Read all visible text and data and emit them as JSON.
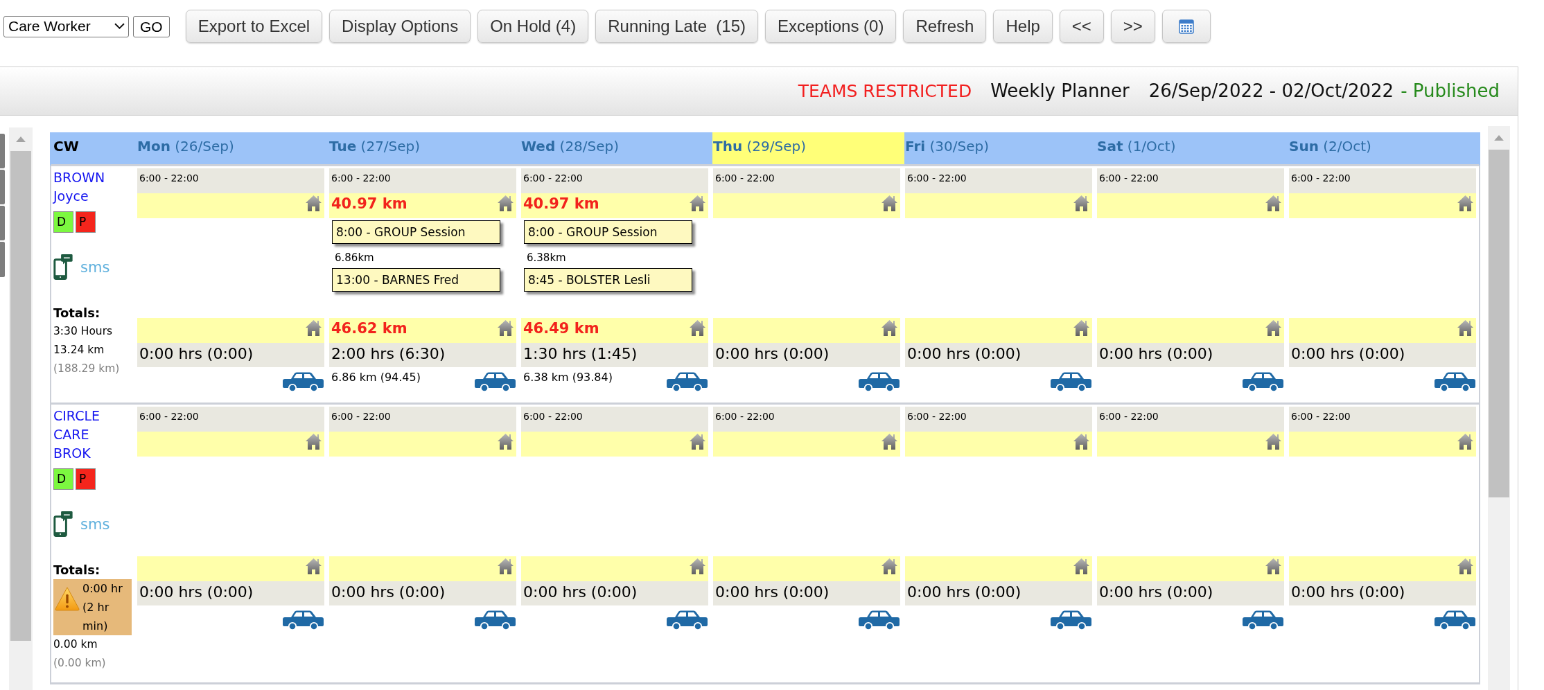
{
  "toolbar": {
    "view_select": {
      "value": "Care Worker"
    },
    "go_button": {
      "label": "GO"
    },
    "buttons": [
      {
        "kind": "text",
        "label": "Export to Excel"
      },
      {
        "kind": "text",
        "label": "Display Options"
      },
      {
        "kind": "text",
        "label": "On Hold (4)"
      },
      {
        "kind": "text",
        "label": "Running Late  (15)"
      },
      {
        "kind": "text",
        "label": "Exceptions (0)"
      },
      {
        "kind": "text",
        "label": "Refresh"
      },
      {
        "kind": "text",
        "label": "Help"
      },
      {
        "kind": "text",
        "label": "<<"
      },
      {
        "kind": "text",
        "label": ">>"
      },
      {
        "kind": "calendar"
      }
    ]
  },
  "header": {
    "restriction": "TEAMS RESTRICTED",
    "title": "Weekly Planner",
    "date_range": "26/Sep/2022 - 02/Oct/2022",
    "status": "- Published"
  },
  "planner": {
    "corner_label": "CW",
    "days": [
      {
        "label": "**Mon** (26/Sep)",
        "today": false
      },
      {
        "label": "**Tue** (27/Sep)",
        "today": false
      },
      {
        "label": "**Wed** (28/Sep)",
        "today": false
      },
      {
        "label": "**Thu** (29/Sep)",
        "today": true
      },
      {
        "label": "**Fri** (30/Sep)",
        "today": false
      },
      {
        "label": "**Sat** (1/Oct)",
        "today": false
      },
      {
        "label": "**Sun** (2/Oct)",
        "today": false
      }
    ],
    "workers": [
      {
        "name": "BROWN Joyce",
        "badges": [
          {
            "label": "D",
            "color": "#7cf840"
          },
          {
            "label": "P",
            "color": "#f4251c"
          }
        ],
        "sms_label": "sms",
        "totals": {
          "label": "Totals:",
          "hours": "3:30 Hours",
          "warning": false,
          "distance": "13.24 km",
          "total_distance": "(188.29 km)"
        },
        "days": [
          {
            "shift": "6:00 - 22:00",
            "hours": "0:00 hrs (0:00)"
          },
          {
            "shift": "6:00 - 22:00",
            "start_distance": "40.97 km",
            "items": [
              {
                "kind": "visit",
                "label": "8:00 - GROUP Session"
              },
              {
                "kind": "travel",
                "label": "6.86km"
              },
              {
                "kind": "visit",
                "label": "13:00 - BARNES Fred"
              }
            ],
            "end_distance": "46.62 km",
            "hours": "2:00 hrs (6:30)",
            "travel": "6.86 km (94.45)"
          },
          {
            "shift": "6:00 - 22:00",
            "start_distance": "40.97 km",
            "items": [
              {
                "kind": "visit",
                "label": "8:00 - GROUP Session"
              },
              {
                "kind": "travel",
                "label": "6.38km"
              },
              {
                "kind": "visit",
                "label": "8:45 - BOLSTER Lesli"
              }
            ],
            "end_distance": "46.49 km",
            "hours": "1:30 hrs (1:45)",
            "travel": "6.38 km (93.84)"
          },
          {
            "shift": "6:00 - 22:00",
            "hours": "0:00 hrs (0:00)"
          },
          {
            "shift": "6:00 - 22:00",
            "hours": "0:00 hrs (0:00)"
          },
          {
            "shift": "6:00 - 22:00",
            "hours": "0:00 hrs (0:00)"
          },
          {
            "shift": "6:00 - 22:00",
            "hours": "0:00 hrs (0:00)"
          }
        ]
      },
      {
        "name": "CIRCLE CARE BROK",
        "badges": [
          {
            "label": "D",
            "color": "#7cf840"
          },
          {
            "label": "P",
            "color": "#f4251c"
          }
        ],
        "sms_label": "sms",
        "totals": {
          "label": "Totals:",
          "hours": "0:00 hr (2 hr min)",
          "warning": true,
          "distance": "0.00 km",
          "total_distance": "(0.00 km)"
        },
        "days": [
          {
            "shift": "6:00 - 22:00",
            "hours": "0:00 hrs (0:00)"
          },
          {
            "shift": "6:00 - 22:00",
            "hours": "0:00 hrs (0:00)"
          },
          {
            "shift": "6:00 - 22:00",
            "hours": "0:00 hrs (0:00)"
          },
          {
            "shift": "6:00 - 22:00",
            "hours": "0:00 hrs (0:00)"
          },
          {
            "shift": "6:00 - 22:00",
            "hours": "0:00 hrs (0:00)"
          },
          {
            "shift": "6:00 - 22:00",
            "hours": "0:00 hrs (0:00)"
          },
          {
            "shift": "6:00 - 22:00",
            "hours": "0:00 hrs (0:00)"
          }
        ]
      }
    ]
  }
}
